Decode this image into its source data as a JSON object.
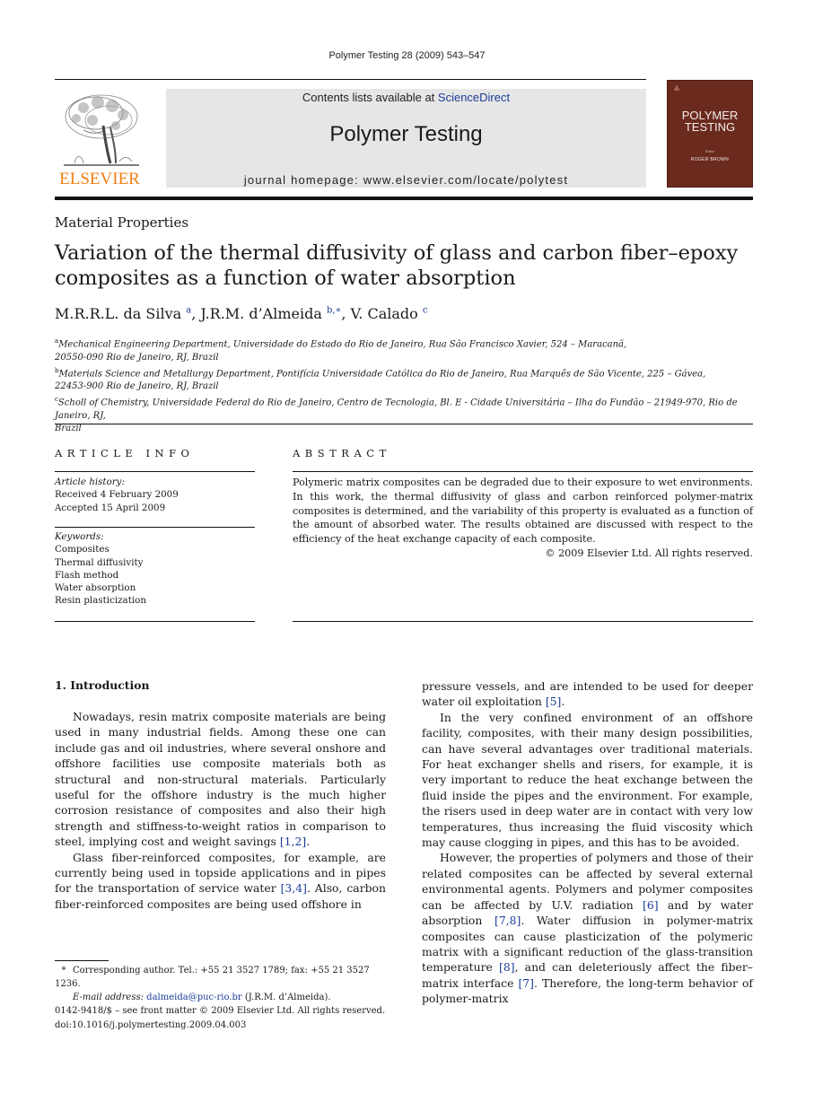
{
  "running_head": "Polymer Testing 28 (2009) 543–547",
  "masthead": {
    "publisher_logo_text": "ELSEVIER",
    "contents_prefix": "Contents lists available at ",
    "contents_link": "ScienceDirect",
    "journal_name": "Polymer Testing",
    "homepage": "journal homepage: www.elsevier.com/locate/polytest",
    "cover": {
      "title_line1": "POLYMER",
      "title_line2": "TESTING",
      "editor_label": "Editor",
      "editor_name": "ROGER BROWN"
    },
    "colors": {
      "elsevier_orange": "#f07f14",
      "cover_brown": "#6b2a1e",
      "link_blue": "#1c3d98",
      "masthead_gray": "#e6e6e6"
    }
  },
  "article": {
    "category": "Material Properties",
    "title": "Variation of the thermal diffusivity of glass and carbon fiber–epoxy composites as a function of water absorption",
    "authors": [
      {
        "name": "M.R.R.L. da Silva",
        "sup": "a"
      },
      {
        "name": "J.R.M. d’Almeida",
        "sup": "b,∗"
      },
      {
        "name": "V. Calado",
        "sup": "c"
      }
    ],
    "affiliations": [
      {
        "key": "a",
        "text": "Mechanical Engineering Department, Universidade do Estado do Rio de Janeiro, Rua São Francisco Xavier, 524 – Maracanã,",
        "text2": "20550-090 Rio de Janeiro, RJ, Brazil"
      },
      {
        "key": "b",
        "text": "Materials Science and Metallurgy Department, Pontifícia Universidade Católica do Rio de Janeiro, Rua Marquês de São Vicente, 225 – Gávea,",
        "text2": "22453-900 Rio de Janeiro, RJ, Brazil"
      },
      {
        "key": "c",
        "text": "Scholl of Chemistry, Universidade Federal do Rio de Janeiro, Centro de Tecnologia, Bl. E - Cidade Universitária – Ilha do Fundão – 21949-970, Rio de Janeiro, RJ,",
        "text2": "Brazil"
      }
    ]
  },
  "article_info": {
    "heading": "ARTICLE INFO",
    "history_label": "Article history:",
    "received": "Received 4 February 2009",
    "accepted": "Accepted 15 April 2009",
    "keywords_label": "Keywords:",
    "keywords": [
      "Composites",
      "Thermal diffusivity",
      "Flash method",
      "Water absorption",
      "Resin plasticization"
    ]
  },
  "abstract": {
    "heading": "ABSTRACT",
    "text": "Polymeric matrix composites can be degraded due to their exposure to wet environments. In this work, the thermal diffusivity of glass and carbon reinforced polymer-matrix composites is determined, and the variability of this property is evaluated as a function of the amount of absorbed water. The results obtained are discussed with respect to the efficiency of the heat exchange capacity of each composite.",
    "copyright": "© 2009 Elsevier Ltd. All rights reserved."
  },
  "body": {
    "section_heading": "1.  Introduction",
    "left": {
      "p1": "Nowadays, resin matrix composite materials are being used in many industrial fields. Among these one can include gas and oil industries, where several onshore and offshore facilities use composite materials both as structural and non-structural materials. Particularly useful for the offshore industry is the much higher corrosion resistance of composites and also their high strength and stiffness-to-weight ratios in comparison to steel, implying cost and weight savings ",
      "p1_ref": "[1,2]",
      "p1_end": ".",
      "p2": "Glass fiber-reinforced composites, for example, are currently being used in topside applications and in pipes for the transportation of service water ",
      "p2_ref": "[3,4]",
      "p2_end": ". Also, carbon fiber-reinforced composites are being used offshore in"
    },
    "right": {
      "p0": "pressure vessels, and are intended to be used for deeper water oil exploitation ",
      "p0_ref": "[5]",
      "p0_end": ".",
      "p1": "In the very confined environment of an offshore facility, composites, with their many design possibilities, can have several advantages over traditional materials. For heat exchanger shells and risers, for example, it is very important to reduce the heat exchange between the fluid inside the pipes and the environment. For example, the risers used in deep water are in contact with very low temperatures, thus increasing the fluid viscosity which may cause clogging in pipes, and this has to be avoided.",
      "p2a": "However, the properties of polymers and those of their related composites can be affected by several external environmental agents. Polymers and polymer composites can be affected by U.V. radiation ",
      "p2_ref1": "[6]",
      "p2b": " and by water absorption ",
      "p2_ref2": "[7,8]",
      "p2c": ". Water diffusion in polymer-matrix composites can cause plasticization of the polymeric matrix with a significant reduction of the glass-transition temperature ",
      "p2_ref3": "[8]",
      "p2d": ", and can deleteriously affect the fiber–matrix interface ",
      "p2_ref4": "[7]",
      "p2e": ". Therefore, the long-term behavior of polymer-matrix"
    }
  },
  "footnote": {
    "star": "*",
    "corresponding": "Corresponding author. Tel.: +55 21 3527 1789; fax: +55 21 3527 1236.",
    "email_label": "E-mail address:",
    "email": "dalmeida@puc-rio.br",
    "email_owner": " (J.R.M. d’Almeida)."
  },
  "imprint": {
    "issn_line": "0142-9418/$ – see front matter © 2009 Elsevier Ltd. All rights reserved.",
    "doi": "doi:10.1016/j.polymertesting.2009.04.003"
  }
}
